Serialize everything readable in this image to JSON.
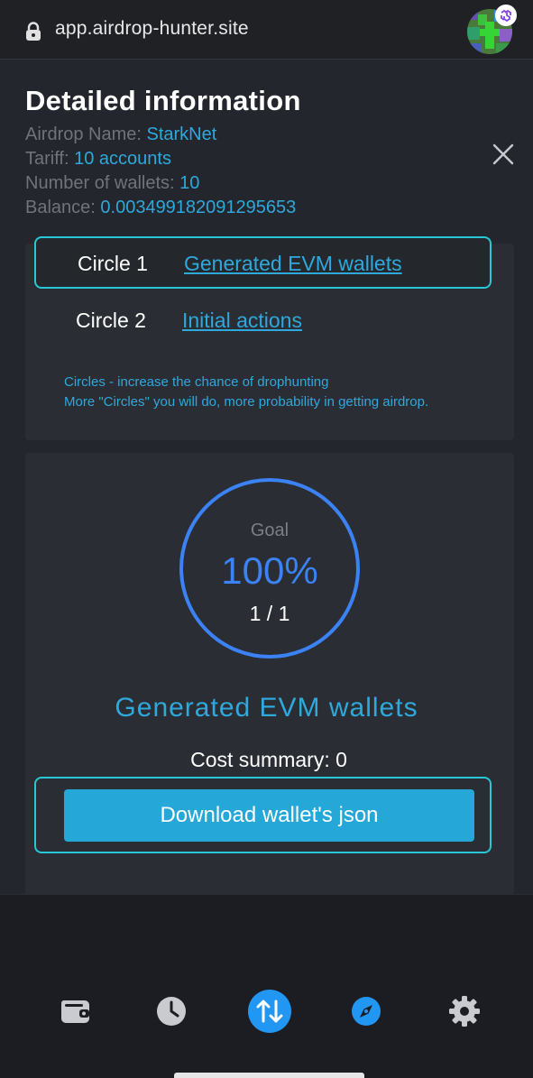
{
  "browser": {
    "url": "app.airdrop-hunter.site"
  },
  "modal": {
    "title": "Detailed information",
    "info": [
      {
        "label": "Airdrop Name: ",
        "value": "StarkNet"
      },
      {
        "label": "Tariff: ",
        "value": "10 accounts"
      },
      {
        "label": "Number of wallets: ",
        "value": "10"
      },
      {
        "label": "Balance: ",
        "value": "0.003499182091295653"
      }
    ]
  },
  "circles": {
    "items": [
      {
        "name": "Circle 1",
        "link": "Generated EVM wallets",
        "active": true
      },
      {
        "name": "Circle 2",
        "link": "Initial actions",
        "active": false
      }
    ],
    "hint_line1": "Circles - increase the chance of drophunting",
    "hint_line2": "More \"Circles\" you will do, more probability in getting airdrop."
  },
  "goal": {
    "label": "Goal",
    "percent": "100%",
    "progress_fraction": 1.0,
    "count": "1 / 1",
    "circle_title": "Generated EVM wallets",
    "cost_summary": "Cost summary: 0",
    "download_label": "Download wallet's json"
  },
  "bottom_nav": {
    "items": [
      {
        "icon": "wallet-icon"
      },
      {
        "icon": "clock-icon"
      },
      {
        "icon": "swap-icon",
        "active": true
      },
      {
        "icon": "compass-icon"
      },
      {
        "icon": "gear-icon"
      }
    ]
  },
  "colors": {
    "accent": "#2fa8dc",
    "border_accent": "#28c7d8",
    "ring": "#3b82f6",
    "background": "#23262c"
  }
}
